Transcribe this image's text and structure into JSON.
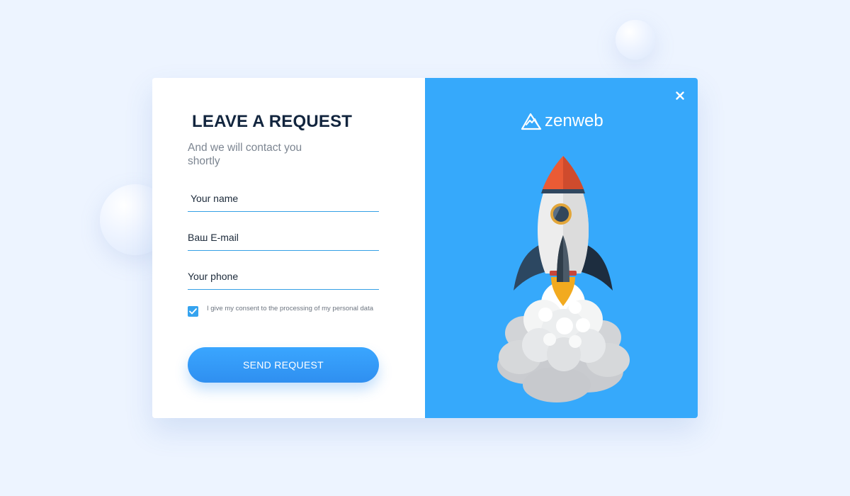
{
  "form": {
    "title": "LEAVE A REQUEST",
    "subtitle": "And we will contact you shortly",
    "name_placeholder": "Your name",
    "email_placeholder": "Ваш E-mail",
    "phone_placeholder": "Your phone",
    "consent_checked": true,
    "consent_text": "I give my consent to the processing of my personal data",
    "send_label": "SEND REQUEST"
  },
  "brand": {
    "logo": "mountain-logo-icon",
    "name": "zenweb"
  },
  "icons": {
    "close": "close-icon",
    "checkbox": "check-icon",
    "illustration": "rocket-launch-illustration"
  },
  "colors": {
    "background": "#edf4ff",
    "panel_blue": "#36a9fb",
    "accent_blue": "#2f8ff0",
    "title_text": "#12253e",
    "muted_text": "#7c8591"
  }
}
